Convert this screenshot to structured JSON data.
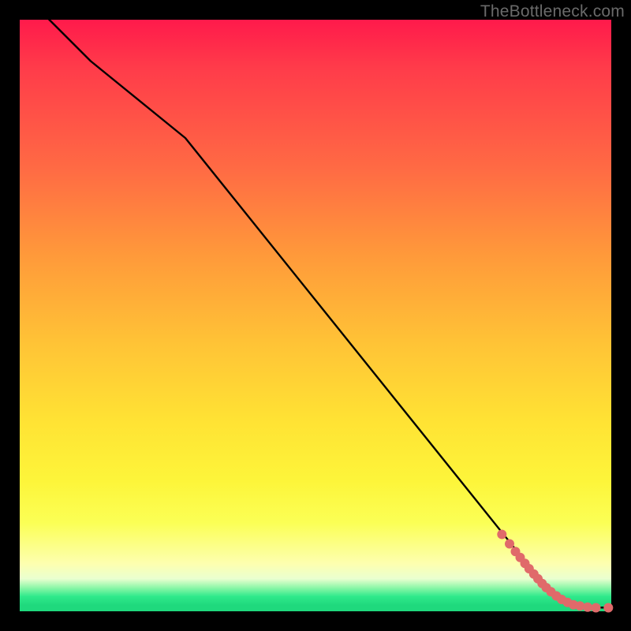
{
  "watermark": "TheBottleneck.com",
  "chart_data": {
    "type": "line",
    "title": "",
    "xlabel": "",
    "ylabel": "",
    "xlim": [
      0,
      100
    ],
    "ylim": [
      0,
      100
    ],
    "series": [
      {
        "name": "curve",
        "x": [
          0,
          12,
          28,
          85,
          89,
          92,
          95,
          100
        ],
        "y": [
          105,
          93,
          80,
          9,
          4,
          1.5,
          0.7,
          0.6
        ]
      }
    ],
    "scatter": {
      "name": "points",
      "color": "#e06a6a",
      "radius": 6,
      "x": [
        81.5,
        82.8,
        83.8,
        84.6,
        85.4,
        86.1,
        86.9,
        87.6,
        88.3,
        89.0,
        89.8,
        90.7,
        91.6,
        92.6,
        93.6,
        94.7,
        96.0,
        97.4,
        99.5
      ],
      "y": [
        13.0,
        11.4,
        10.1,
        9.1,
        8.1,
        7.2,
        6.3,
        5.5,
        4.7,
        4.0,
        3.3,
        2.6,
        2.0,
        1.5,
        1.1,
        0.9,
        0.7,
        0.6,
        0.6
      ]
    }
  }
}
